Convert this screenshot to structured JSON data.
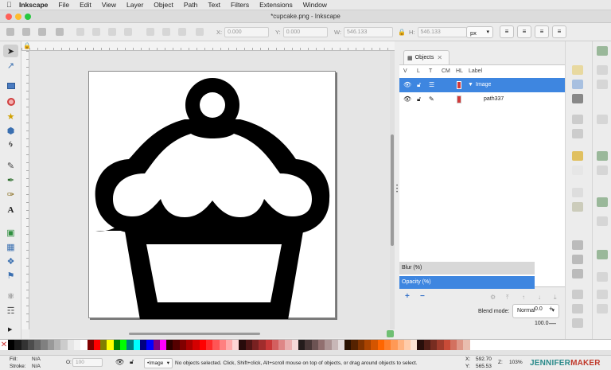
{
  "menubar": {
    "app": "Inkscape",
    "items": [
      "File",
      "Edit",
      "View",
      "Layer",
      "Object",
      "Path",
      "Text",
      "Filters",
      "Extensions",
      "Window"
    ]
  },
  "window": {
    "title": "*cupcake.png - Inkscape"
  },
  "toolcontrols": {
    "x_label": "X:",
    "x_value": "0.000",
    "y_label": "Y:",
    "y_value": "0.000",
    "w_label": "W:",
    "w_value": "546.133",
    "h_label": "H:",
    "h_value": "546.133",
    "units": "px"
  },
  "objects_panel": {
    "tab_label": "Objects",
    "columns": [
      "V",
      "L",
      "T",
      "CM",
      "HL",
      "Label"
    ],
    "rows": [
      {
        "label": "Image",
        "selected": true,
        "expanded": true
      },
      {
        "label": "path337",
        "selected": false
      }
    ],
    "blend_label": "Blend mode:",
    "blend_value": "Normal",
    "blur_label": "Blur (%)",
    "blur_value": "0.0",
    "opacity_label": "Opacity (%)",
    "opacity_value": "100.0"
  },
  "statusbar": {
    "fill_label": "Fill:",
    "fill_value": "N/A",
    "stroke_label": "Stroke:",
    "stroke_value": "N/A",
    "o_label": "O:",
    "o_value": "100",
    "layer": "•Image",
    "message": "No objects selected. Click, Shift+click, Alt+scroll mouse on top of objects, or drag around objects to select.",
    "x_label": "X:",
    "x_value": "592.70",
    "y_label": "Y:",
    "y_value": "565.53",
    "z_label": "Z:",
    "zoom": "103%",
    "brand": "JENNIFERMAKER"
  },
  "colors": {
    "selection": "#3e86e0",
    "palette": [
      "#000000",
      "#1a1a1a",
      "#333333",
      "#4d4d4d",
      "#666666",
      "#808080",
      "#999999",
      "#b3b3b3",
      "#cccccc",
      "#e6e6e6",
      "#f2f2f2",
      "#ffffff",
      "#800000",
      "#ff0000",
      "#808000",
      "#ffff00",
      "#008000",
      "#00ff00",
      "#008080",
      "#00ffff",
      "#000080",
      "#0000ff",
      "#800080",
      "#ff00ff",
      "#2b0000",
      "#550000",
      "#800000",
      "#aa0000",
      "#d40000",
      "#ff0000",
      "#ff2a2a",
      "#ff5555",
      "#ff8080",
      "#ffaaaa",
      "#ffd5d5",
      "#280b0b",
      "#501616",
      "#782121",
      "#a02c2c",
      "#c83737",
      "#d35f5f",
      "#de8787",
      "#e9afaf",
      "#f4d7d7",
      "#241c1c",
      "#483737",
      "#6c5353",
      "#916f6f",
      "#ac9393",
      "#c8b7b7",
      "#e3dbdb",
      "#2b1100",
      "#552200",
      "#803300",
      "#aa4400",
      "#d45500",
      "#ff6600",
      "#ff7f2a",
      "#ff9955",
      "#ffb380",
      "#ffccaa",
      "#ffe6d5",
      "#280f0b",
      "#501e16",
      "#782d21",
      "#a03c2c",
      "#c84b37",
      "#d3715f",
      "#de9787",
      "#e9bdaf"
    ]
  }
}
